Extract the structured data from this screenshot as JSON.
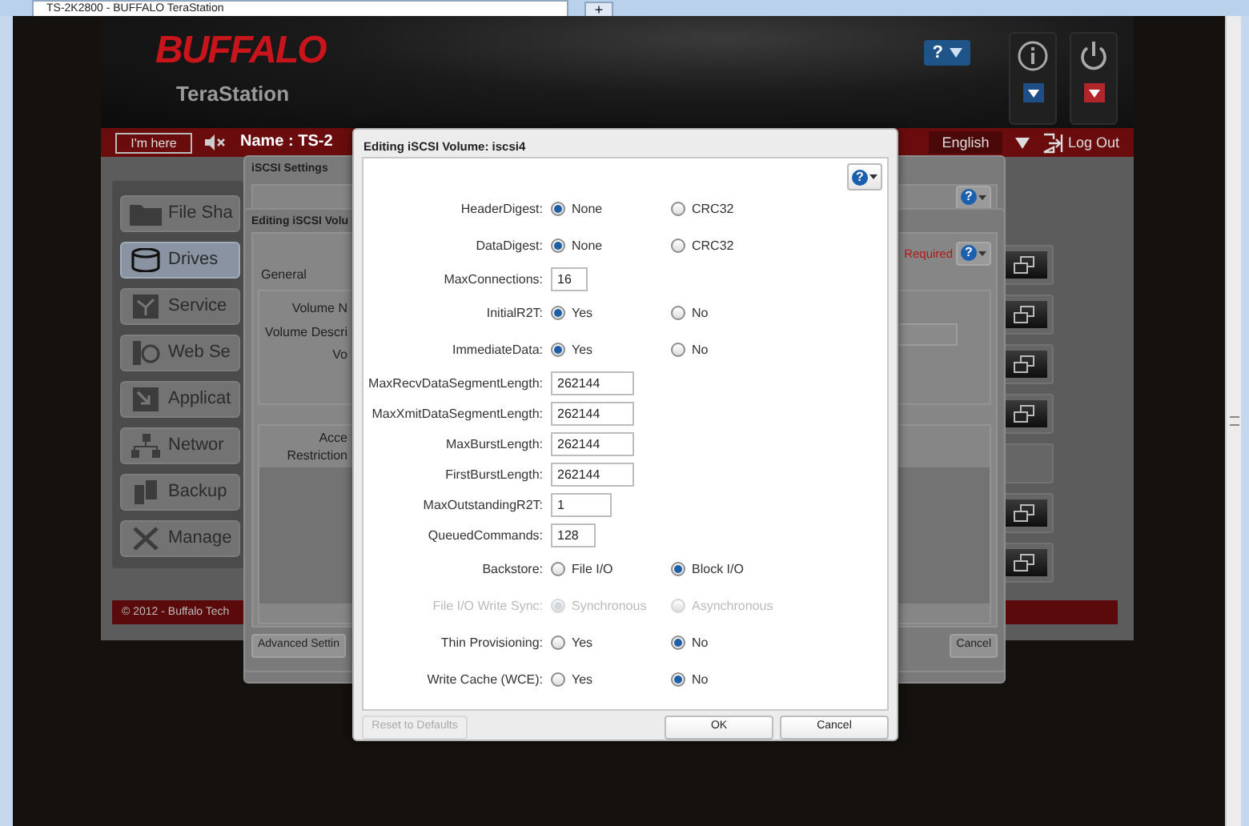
{
  "browser": {
    "tab_title": "TS-2K2800 - BUFFALO TeraStation",
    "new_tab": "+"
  },
  "header": {
    "logo": "BUFFALO",
    "product": "TeraStation",
    "help_label": "?"
  },
  "top_bar": {
    "im_here": "I'm here",
    "name": "Name : TS-2",
    "language": "English",
    "logout": "Log Out"
  },
  "sidebar": {
    "items": [
      {
        "label": "File Sha",
        "selected": false
      },
      {
        "label": "Drives",
        "selected": true
      },
      {
        "label": "Service",
        "selected": false
      },
      {
        "label": "Web Se",
        "selected": false
      },
      {
        "label": "Applicat",
        "selected": false
      },
      {
        "label": "Networ",
        "selected": false
      },
      {
        "label": "Backup",
        "selected": false
      },
      {
        "label": "Manage",
        "selected": false
      }
    ]
  },
  "side_actions": [
    {
      "kind": "button"
    },
    {
      "kind": "button"
    },
    {
      "kind": "button"
    },
    {
      "kind": "button"
    },
    {
      "kind": "blank"
    },
    {
      "kind": "button"
    },
    {
      "kind": "button"
    }
  ],
  "footer": "© 2012 - Buffalo Tech",
  "iscsi_settings_dialog": {
    "title": "iSCSI Settings",
    "help_label": "?"
  },
  "volume_dialog": {
    "title": "Editing iSCSI Volu",
    "required": "Required",
    "help_label": "?",
    "section": "General",
    "general_labels": [
      "Volume N",
      "Volume Descri",
      "Vo"
    ],
    "access_labels": [
      "Acce",
      "Restriction"
    ],
    "buttons": [
      "Advanced Settin",
      "Cancel"
    ]
  },
  "edit_dialog": {
    "title": "Editing iSCSI Volume: iscsi4",
    "help_label": "?",
    "fields": [
      {
        "kind": "radio",
        "label": "HeaderDigest:",
        "disabled": false,
        "options": [
          {
            "label": "None",
            "selected": true
          },
          {
            "label": "CRC32",
            "selected": false
          }
        ]
      },
      {
        "kind": "radio",
        "label": "DataDigest:",
        "disabled": false,
        "options": [
          {
            "label": "None",
            "selected": true
          },
          {
            "label": "CRC32",
            "selected": false
          }
        ]
      },
      {
        "kind": "text",
        "label": "MaxConnections:",
        "value": "16"
      },
      {
        "kind": "radio",
        "label": "InitialR2T:",
        "disabled": false,
        "options": [
          {
            "label": "Yes",
            "selected": true
          },
          {
            "label": "No",
            "selected": false
          }
        ]
      },
      {
        "kind": "radio",
        "label": "ImmediateData:",
        "disabled": false,
        "options": [
          {
            "label": "Yes",
            "selected": true
          },
          {
            "label": "No",
            "selected": false
          }
        ]
      },
      {
        "kind": "text",
        "label": "MaxRecvDataSegmentLength:",
        "value": "262144"
      },
      {
        "kind": "text",
        "label": "MaxXmitDataSegmentLength:",
        "value": "262144"
      },
      {
        "kind": "text",
        "label": "MaxBurstLength:",
        "value": "262144"
      },
      {
        "kind": "text",
        "label": "FirstBurstLength:",
        "value": "262144"
      },
      {
        "kind": "text",
        "label": "MaxOutstandingR2T:",
        "value": "1"
      },
      {
        "kind": "text",
        "label": "QueuedCommands:",
        "value": "128"
      },
      {
        "kind": "radio",
        "label": "Backstore:",
        "disabled": false,
        "options": [
          {
            "label": "File I/O",
            "selected": false
          },
          {
            "label": "Block I/O",
            "selected": true
          }
        ]
      },
      {
        "kind": "radio",
        "label": "File I/O Write Sync:",
        "disabled": true,
        "options": [
          {
            "label": "Synchronous",
            "selected": true
          },
          {
            "label": "Asynchronous",
            "selected": false
          }
        ]
      },
      {
        "kind": "radio",
        "label": "Thin Provisioning:",
        "disabled": false,
        "options": [
          {
            "label": "Yes",
            "selected": false
          },
          {
            "label": "No",
            "selected": true
          }
        ]
      },
      {
        "kind": "radio",
        "label": "Write Cache (WCE):",
        "disabled": false,
        "options": [
          {
            "label": "Yes",
            "selected": false
          },
          {
            "label": "No",
            "selected": true
          }
        ]
      }
    ],
    "buttons": [
      {
        "label": "Reset to Defaults",
        "disabled": true,
        "kind": "left"
      },
      {
        "label": "OK",
        "disabled": false,
        "kind": "right"
      },
      {
        "label": "Cancel",
        "disabled": false,
        "kind": "right"
      }
    ]
  }
}
